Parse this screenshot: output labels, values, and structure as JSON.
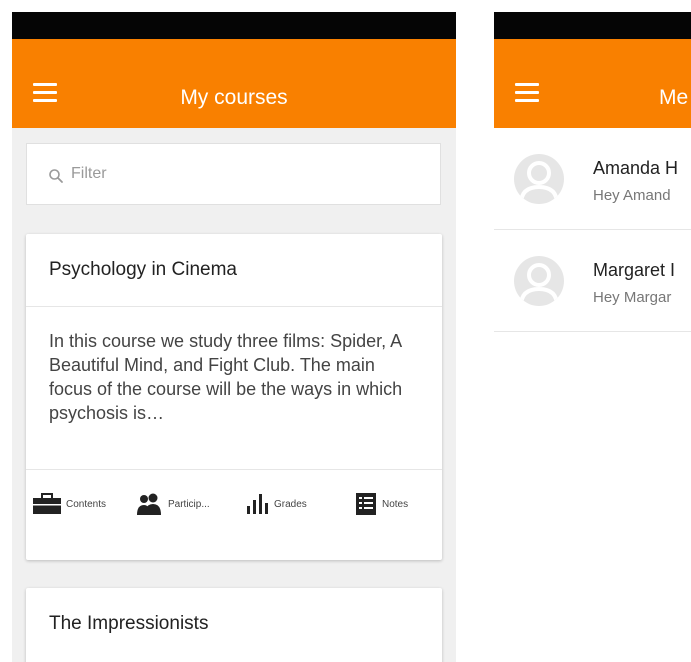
{
  "left_screen": {
    "title": "My courses",
    "filter": {
      "placeholder": "Filter"
    },
    "courses": [
      {
        "title": "Psychology in Cinema",
        "summary": "In this course we study three films: Spider, A Beautiful Mind, and Fight Club. The main focus of the course will be the ways in which psychosis is…",
        "actions": [
          {
            "label": "Contents",
            "icon": "briefcase-icon"
          },
          {
            "label": "Particip...",
            "icon": "participants-icon"
          },
          {
            "label": "Grades",
            "icon": "bar-chart-icon"
          },
          {
            "label": "Notes",
            "icon": "notes-icon"
          }
        ]
      },
      {
        "title": "The Impressionists"
      }
    ]
  },
  "right_screen": {
    "title": "Me",
    "messages": [
      {
        "name": "Amanda H",
        "preview": "Hey Amand"
      },
      {
        "name": "Margaret I",
        "preview": "Hey Margar"
      }
    ]
  },
  "colors": {
    "accent": "#f98000",
    "statusbar": "#050505"
  }
}
